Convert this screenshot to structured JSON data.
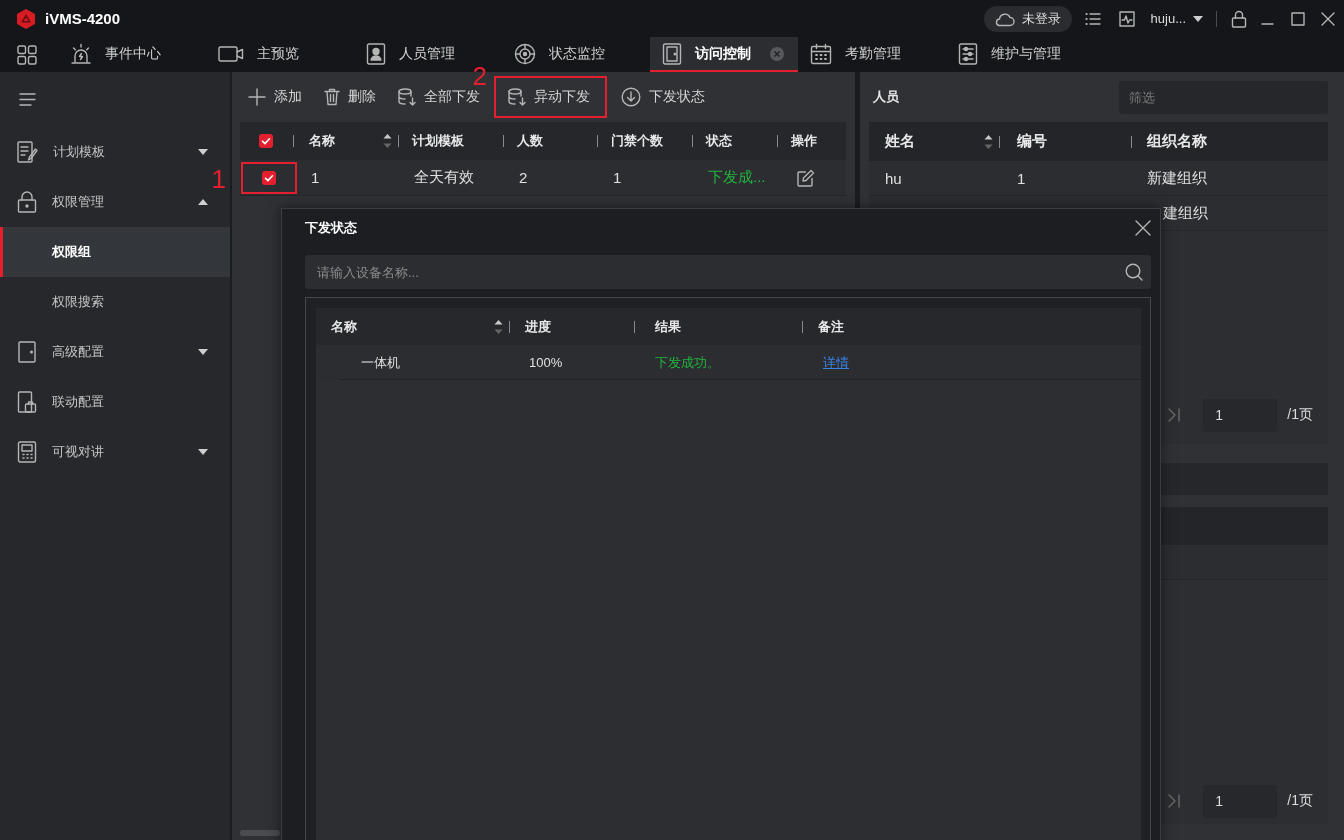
{
  "app": {
    "title": "iVMS-4200"
  },
  "account": {
    "cloud_status": "未登录",
    "user": "huju..."
  },
  "nav_tabs": [
    {
      "label": "事件中心",
      "kind": "alarm",
      "selected": false,
      "closable": false
    },
    {
      "label": "主预览",
      "kind": "camera",
      "selected": false,
      "closable": false
    },
    {
      "label": "人员管理",
      "kind": "person",
      "selected": false,
      "closable": false
    },
    {
      "label": "状态监控",
      "kind": "monitor",
      "selected": false,
      "closable": false
    },
    {
      "label": "访问控制",
      "kind": "door",
      "selected": true,
      "closable": true
    },
    {
      "label": "考勤管理",
      "kind": "calendar",
      "selected": false,
      "closable": false
    },
    {
      "label": "维护与管理",
      "kind": "maintenance",
      "selected": false,
      "closable": false
    }
  ],
  "sidebar": {
    "items": [
      {
        "label": "计划模板",
        "kind": "schedule",
        "expanded": false
      },
      {
        "label": "权限管理",
        "kind": "lock",
        "expanded": true,
        "children": [
          {
            "label": "权限组",
            "selected": true
          },
          {
            "label": "权限搜索",
            "selected": false
          }
        ]
      },
      {
        "label": "高级配置",
        "kind": "door",
        "expanded": false
      },
      {
        "label": "联动配置",
        "kind": "linkage"
      },
      {
        "label": "可视对讲",
        "kind": "intercom",
        "expanded": false
      }
    ]
  },
  "toolbar": [
    {
      "label": "添加",
      "kind": "add",
      "highlighted": false
    },
    {
      "label": "删除",
      "kind": "delete",
      "highlighted": false
    },
    {
      "label": "全部下发",
      "kind": "apply_all",
      "highlighted": false
    },
    {
      "label": "异动下发",
      "kind": "apply_changes",
      "highlighted": true,
      "callout": "2"
    },
    {
      "label": "下发状态",
      "kind": "status",
      "highlighted": false
    }
  ],
  "group_table": {
    "all_checked": true,
    "columns": [
      {
        "label": "名称",
        "sortable": true
      },
      {
        "label": "计划模板",
        "sortable": false
      },
      {
        "label": "人数",
        "sortable": false
      },
      {
        "label": "门禁个数",
        "sortable": false
      },
      {
        "label": "状态",
        "sortable": false
      },
      {
        "label": "操作",
        "sortable": false
      }
    ],
    "rows": [
      {
        "checked": true,
        "highlighted": true,
        "callout": "1",
        "name": "1",
        "template": "全天有效",
        "people": "2",
        "doors": "1",
        "status": {
          "text": "下发成...",
          "kind": "success"
        }
      }
    ]
  },
  "people_panel": {
    "title": "人员",
    "filter_placeholder": "筛选",
    "columns": [
      {
        "label": "姓名",
        "sortable": true
      },
      {
        "label": "编号",
        "sortable": false
      },
      {
        "label": "组织名称",
        "sortable": false
      }
    ],
    "rows": [
      {
        "name": "hu",
        "number": "1",
        "organization": "新建组织"
      },
      {
        "organization": "建组织"
      }
    ],
    "pagination": {
      "page": "1",
      "total": "/1页"
    }
  },
  "lower_panel": {
    "pagination": {
      "page": "1",
      "total": "/1页"
    }
  },
  "dialog": {
    "title": "下发状态",
    "search_placeholder": "请输入设备名称...",
    "columns": [
      {
        "label": "名称",
        "sortable": true
      },
      {
        "label": "进度",
        "sortable": false
      },
      {
        "label": "结果",
        "sortable": false
      },
      {
        "label": "备注",
        "sortable": false
      }
    ],
    "rows": [
      {
        "name": "一体机",
        "progress": "100%",
        "result": {
          "text": "下发成功。",
          "kind": "success"
        },
        "remark": "详情"
      }
    ]
  }
}
